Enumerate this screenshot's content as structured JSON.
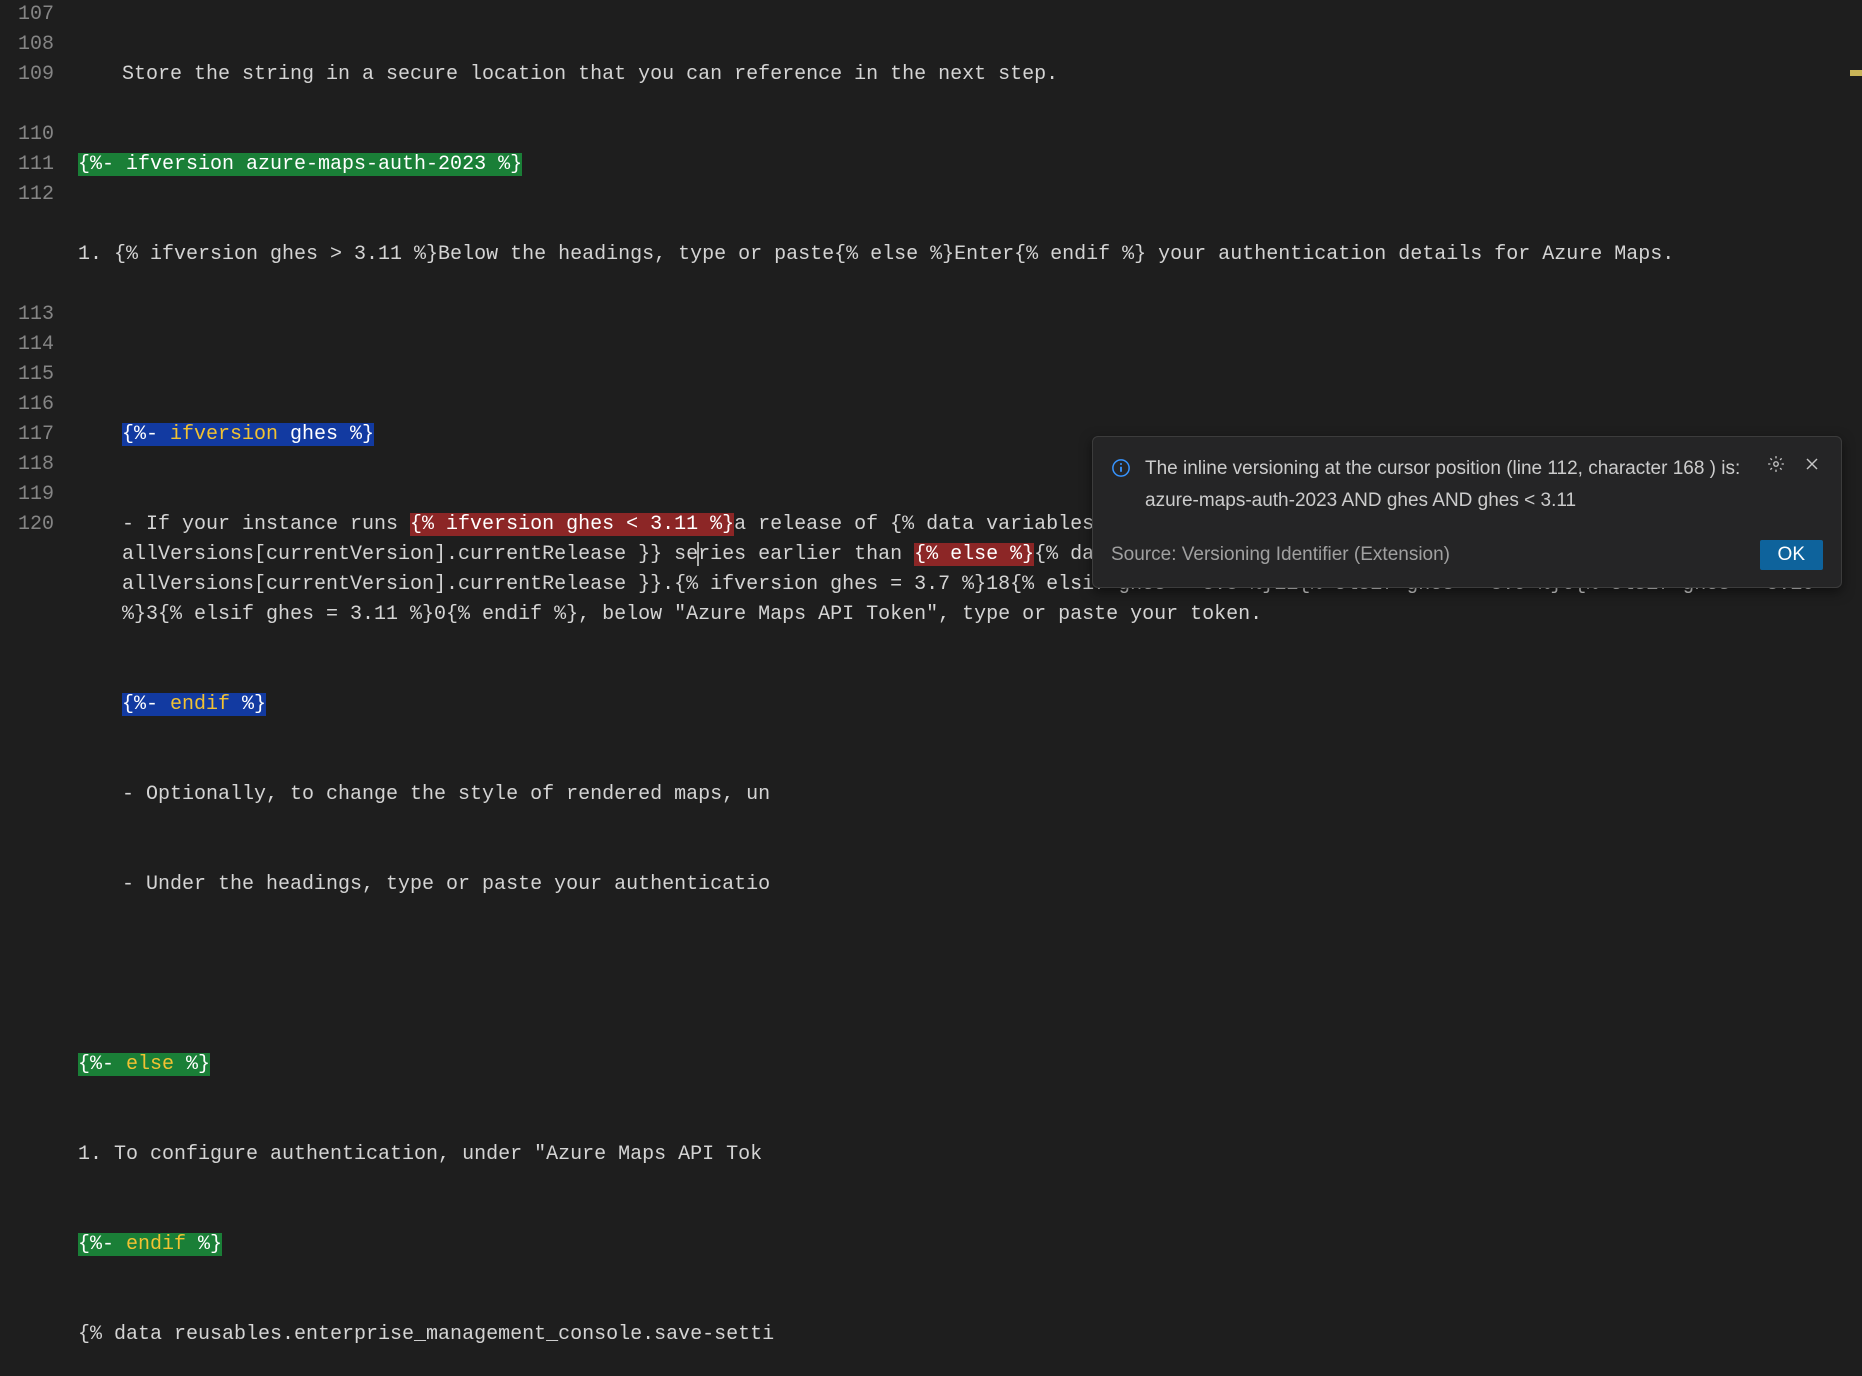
{
  "lines": {
    "l107": {
      "num": "107",
      "text": "Store the string in a secure location that you can reference in the next step."
    },
    "l108": {
      "num": "108",
      "tag": "{%- ifversion azure-maps-auth-2023 %}"
    },
    "l109": {
      "num": "109",
      "text": "1. {% ifversion ghes > 3.11 %}Below the headings, type or paste{% else %}Enter{% endif %} your authentication details for Azure Maps."
    },
    "l110": {
      "num": "110"
    },
    "l111": {
      "num": "111",
      "tag_open": "{%- ",
      "tag_kw": "ifversion",
      "tag_rest": " ghes %}"
    },
    "l112": {
      "num": "112",
      "p1": "- If your instance runs ",
      "red1": "{% ifversion ghes < 3.11 %}",
      "p2": "a release of {% data variables.product.product_name %} in the {{ allVersions[currentVersion].currentRelease }} se",
      "p3": "ries earlier than ",
      "red2": "{% else %}",
      "p4": "{% data variables.product.product_name %} ",
      "red3": "{% endif %}",
      "p5": "{{ allVersions[currentVersion].currentRelease }}.{% ifversion ghes = 3.7 %}18{% elsif ghes = 3.8 %}11{% elsif ghes = 3.9 %}6{% elsif ghes = 3.10 %}3{% elsif ghes = 3.11 %}0{% endif %}, below \"Azure Maps API Token\", type or paste your token."
    },
    "l113": {
      "num": "113",
      "tag_open": "{%- ",
      "tag_kw": "endif",
      "tag_rest": " %}"
    },
    "l114": {
      "num": "114",
      "text": "- Optionally, to change the style of rendered maps, un"
    },
    "l115": {
      "num": "115",
      "text": "- Under the headings, type or paste your authenticatio"
    },
    "l116": {
      "num": "116"
    },
    "l117": {
      "num": "117",
      "tag_open": "{%- ",
      "tag_kw": "else",
      "tag_rest": " %}"
    },
    "l118": {
      "num": "118",
      "text": "1. To configure authentication, under \"Azure Maps API Tok"
    },
    "l119": {
      "num": "119",
      "tag_open": "{%- ",
      "tag_kw": "endif",
      "tag_rest": " %}"
    },
    "l120": {
      "num": "120",
      "text": "{% data reusables.enterprise_management_console.save-setti"
    }
  },
  "notification": {
    "message": "The inline versioning at the cursor position (line 112, character 168 ) is: azure-maps-auth-2023 AND ghes AND ghes < 3.11",
    "source": "Source: Versioning Identifier (Extension)",
    "ok": "OK"
  }
}
